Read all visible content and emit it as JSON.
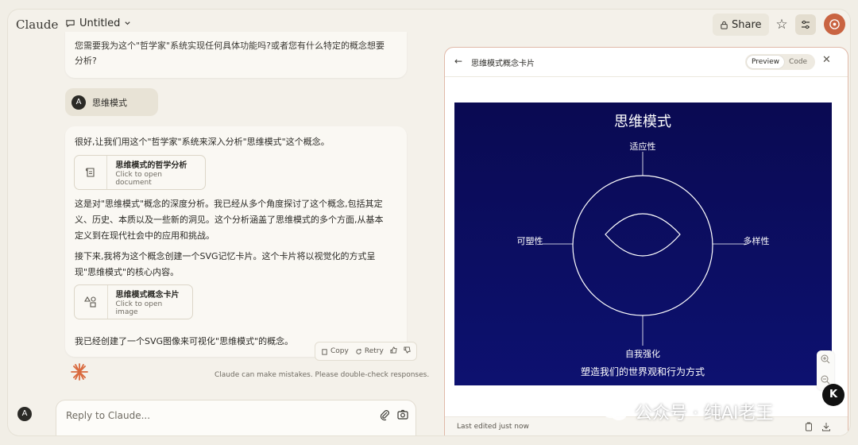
{
  "header": {
    "logo": "Claude",
    "doc_title": "Untitled",
    "share_label": "Share"
  },
  "chat": {
    "prev_message": "您需要我为这个\"哲学家\"系统实现任何具体功能吗?或者您有什么特定的概念想要分析?",
    "user_avatar": "A",
    "user_message": "思维模式",
    "assistant": {
      "p1": "很好,让我们用这个\"哲学家\"系统来深入分析\"思维模式\"这个概念。",
      "artifact1": {
        "title": "思维模式的哲学分析",
        "subtitle": "Click to open document",
        "icon": "document-icon"
      },
      "p2": "这是对\"思维模式\"概念的深度分析。我已经从多个角度探讨了这个概念,包括其定义、历史、本质以及一些新的洞见。这个分析涵盖了思维模式的多个方面,从基本定义到在现代社会中的应用和挑战。",
      "p3": "接下来,我将为这个概念创建一个SVG记忆卡片。这个卡片将以视觉化的方式呈现\"思维模式\"的核心内容。",
      "artifact2": {
        "title": "思维模式概念卡片",
        "subtitle": "Click to open image",
        "icon": "shapes-icon"
      },
      "p4": "我已经创建了一个SVG图像来可视化\"思维模式\"的概念。"
    },
    "actions": {
      "copy": "Copy",
      "retry": "Retry"
    },
    "disclaimer": "Claude can make mistakes. Please double-check responses.",
    "me_avatar": "A",
    "reply_placeholder": "Reply to Claude..."
  },
  "panel": {
    "title": "思维模式概念卡片",
    "tab_preview": "Preview",
    "tab_code": "Code",
    "footer": "Last edited just now",
    "card": {
      "heading": "思维模式",
      "top": "适应性",
      "left": "可塑性",
      "right": "多样性",
      "bottom": "自我强化",
      "caption": "塑造我们的世界观和行为方式"
    }
  },
  "watermark": "公众号 · 纯AI老王",
  "colors": {
    "accent": "#c96442",
    "card_bg": "#0b0b54"
  }
}
